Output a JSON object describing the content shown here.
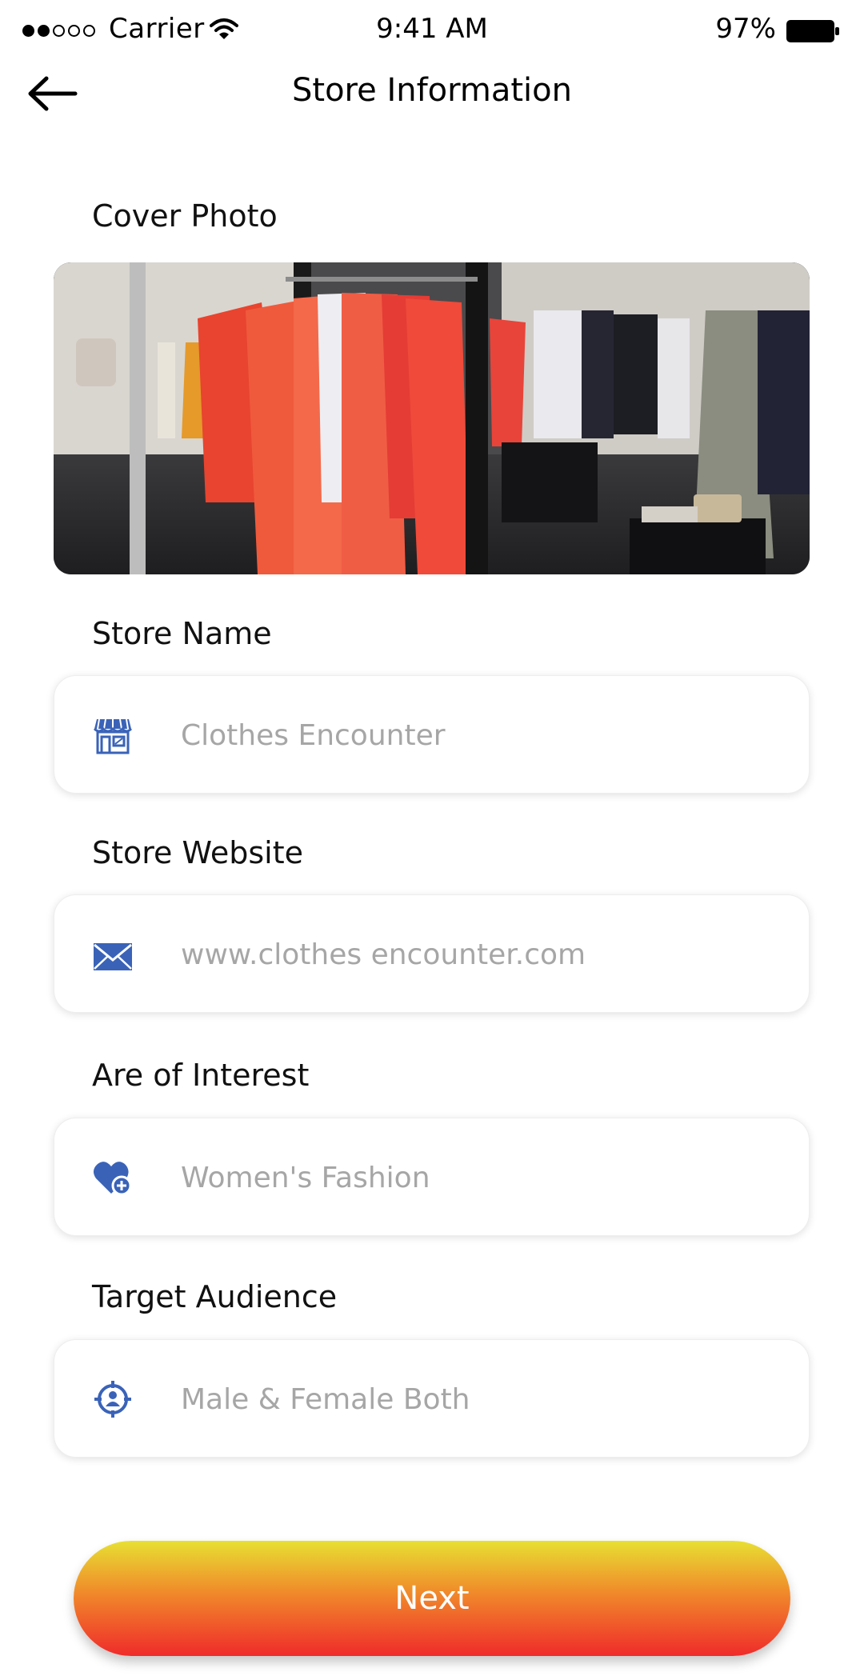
{
  "status_bar": {
    "carrier": "Carrier",
    "time": "9:41 AM",
    "battery": "97%"
  },
  "nav": {
    "title": "Store Information",
    "back_icon": "arrow-left-icon"
  },
  "sections": {
    "cover_photo": {
      "label": "Cover Photo"
    },
    "store_name": {
      "label": "Store Name",
      "placeholder": "Clothes Encounter",
      "icon": "store-icon"
    },
    "store_website": {
      "label": "Store Website",
      "placeholder": "www.clothes encounter.com",
      "icon": "envelope-icon"
    },
    "area_of_interest": {
      "label": "Are of Interest",
      "placeholder": "Women's Fashion",
      "icon": "heart-plus-icon"
    },
    "target_audience": {
      "label": "Target Audience",
      "placeholder": "Male & Female Both",
      "icon": "target-person-icon"
    }
  },
  "next_button": {
    "label": "Next"
  },
  "colors": {
    "icon_blue": "#3a63b8",
    "button_top": "#e7e033",
    "button_bottom": "#ef2b2b"
  }
}
